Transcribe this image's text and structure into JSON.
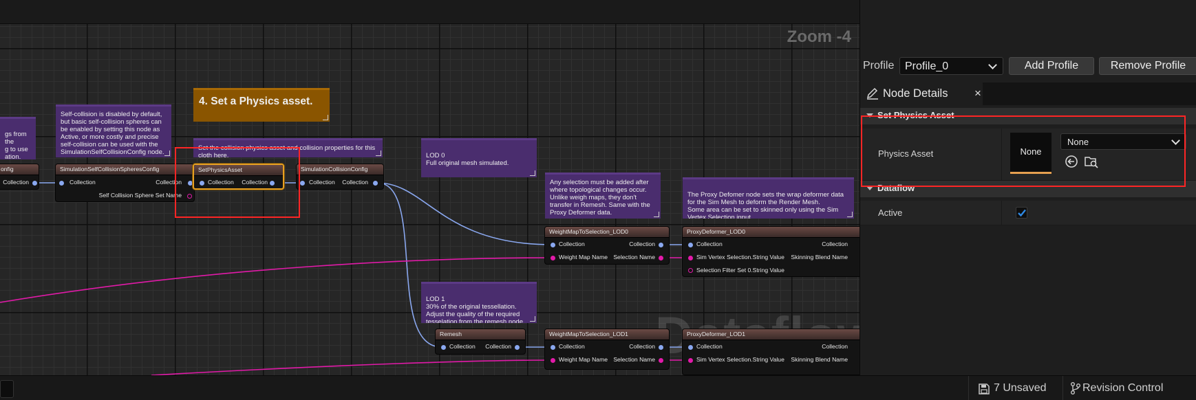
{
  "graph": {
    "zoom_label": "Zoom -4",
    "watermark": "Dataflow",
    "comments": {
      "partial_left": "gs from the\ng to use\nation.",
      "self_collision": "Self-collision is disabled by default, but basic self-collision spheres can be enabled by setting this node as Active, or more costly and precise self-collision can be used with the SimulationSelfCollisionConfig node.",
      "step4": "4. Set a Physics asset.",
      "collision_props": "Set the collision physics asset and collision properties for this cloth here.",
      "lod0": "LOD 0\nFull original mesh simulated.",
      "selection": "Any selection must be added after where topological changes occur. Unlike weigh maps, they don't transfer in Remesh. Same with the Proxy Deformer data.",
      "proxy": "The Proxy Defomer node sets the wrap deformer data for the Sim Mesh to deform the Render Mesh.\nSome area can be set to skinned only using the Sim Vertex Selection input.",
      "lod1": "LOD 1\n30% of the original tessellation.\nAdjust the quality of the required tesselation from the remesh node."
    },
    "nodes": {
      "partial": {
        "title": "onfig",
        "out": "Collection"
      },
      "self_collision": {
        "title": "SimulationSelfCollisionSpheresConfig",
        "in": "Collection",
        "out": "Collection",
        "extra": "Self Collision Sphere Set Name"
      },
      "set_physics": {
        "title": "SetPhysicsAsset",
        "in": "Collection",
        "out": "Collection"
      },
      "collision_config": {
        "title": "SimulationCollisionConfig",
        "in": "Collection",
        "out": "Collection"
      },
      "weightmap_lod0": {
        "title": "WeightMapToSelection_LOD0",
        "in": "Collection",
        "out": "Collection",
        "in2": "Weight Map Name",
        "out2": "Selection Name"
      },
      "proxy_lod0": {
        "title": "ProxyDeformer_LOD0",
        "in": "Collection",
        "out": "Collection",
        "in2": "Sim Vertex Selection.String Value",
        "out2": "Skinning Blend Name",
        "in3": "Selection Filter Set 0.String Value"
      },
      "remesh": {
        "title": "Remesh",
        "in": "Collection",
        "out": "Collection"
      },
      "weightmap_lod1": {
        "title": "WeightMapToSelection_LOD1",
        "in": "Collection",
        "out": "Collection",
        "in2": "Weight Map Name",
        "out2": "Selection Name"
      },
      "proxy_lod1": {
        "title": "ProxyDeformer_LOD1",
        "in": "Collection",
        "out": "Collection",
        "in2": "Sim Vertex Selection.String Value",
        "out2": "Skinning Blend Name"
      }
    }
  },
  "panel": {
    "profile_label": "Profile",
    "profile_value": "Profile_0",
    "add_profile": "Add Profile",
    "remove_profile": "Remove Profile",
    "tab_label": "Node Details",
    "tab_close": "×",
    "section_physics": "Set Physics Asset",
    "physics_asset_label": "Physics Asset",
    "physics_asset_thumb": "None",
    "physics_asset_value": "None",
    "section_dataflow": "Dataflow",
    "active_label": "Active",
    "active_checked": true
  },
  "status": {
    "unsaved": "7 Unsaved",
    "revision": "Revision Control"
  },
  "colors": {
    "collection_pin": "#8aa8f0",
    "name_pin": "#e21aa9",
    "comment": "#4a2d6e",
    "step_comment": "#8a5500",
    "selected_node": "#e8a020",
    "highlight_box": "#ff2525",
    "checkbox": "#2f8ae5"
  }
}
